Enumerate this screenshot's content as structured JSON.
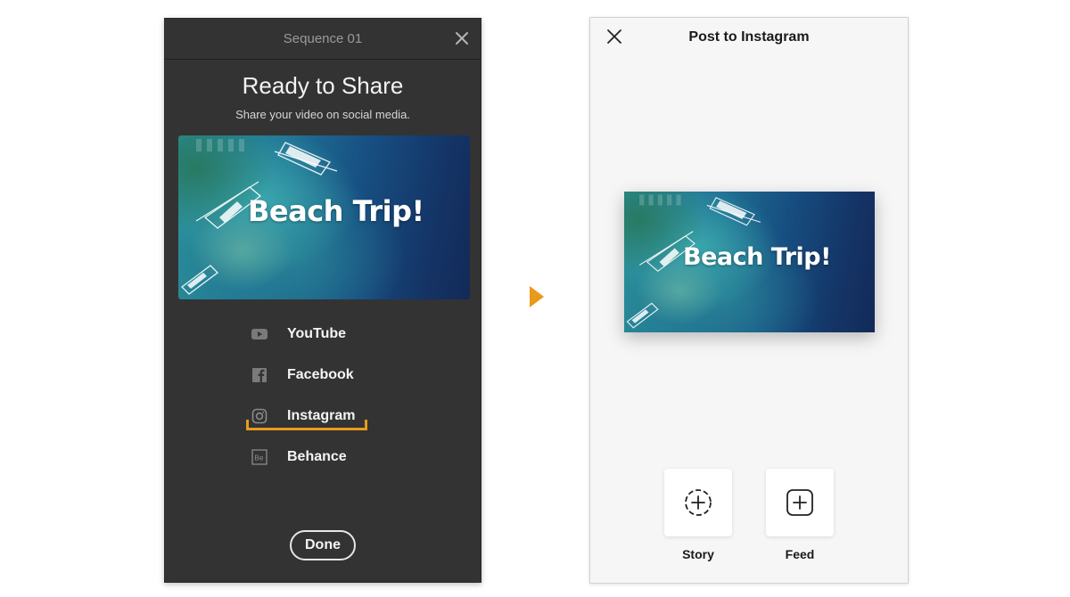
{
  "share_dialog": {
    "title": "Sequence 01",
    "heading": "Ready to Share",
    "subheading": "Share your video on social media.",
    "thumbnail_text": "Beach Trip!",
    "services": [
      {
        "label": "YouTube",
        "icon": "youtube-icon"
      },
      {
        "label": "Facebook",
        "icon": "facebook-icon"
      },
      {
        "label": "Instagram",
        "icon": "instagram-icon"
      },
      {
        "label": "Behance",
        "icon": "behance-icon"
      }
    ],
    "highlighted_service": "Instagram",
    "done_label": "Done"
  },
  "post_dialog": {
    "title": "Post to Instagram",
    "thumbnail_text": "Beach Trip!",
    "options": [
      {
        "label": "Story",
        "icon": "story-add-icon"
      },
      {
        "label": "Feed",
        "icon": "feed-add-icon"
      }
    ]
  },
  "colors": {
    "dark_panel": "#333333",
    "light_panel": "#f6f6f6",
    "accent": "#e89a1c"
  }
}
